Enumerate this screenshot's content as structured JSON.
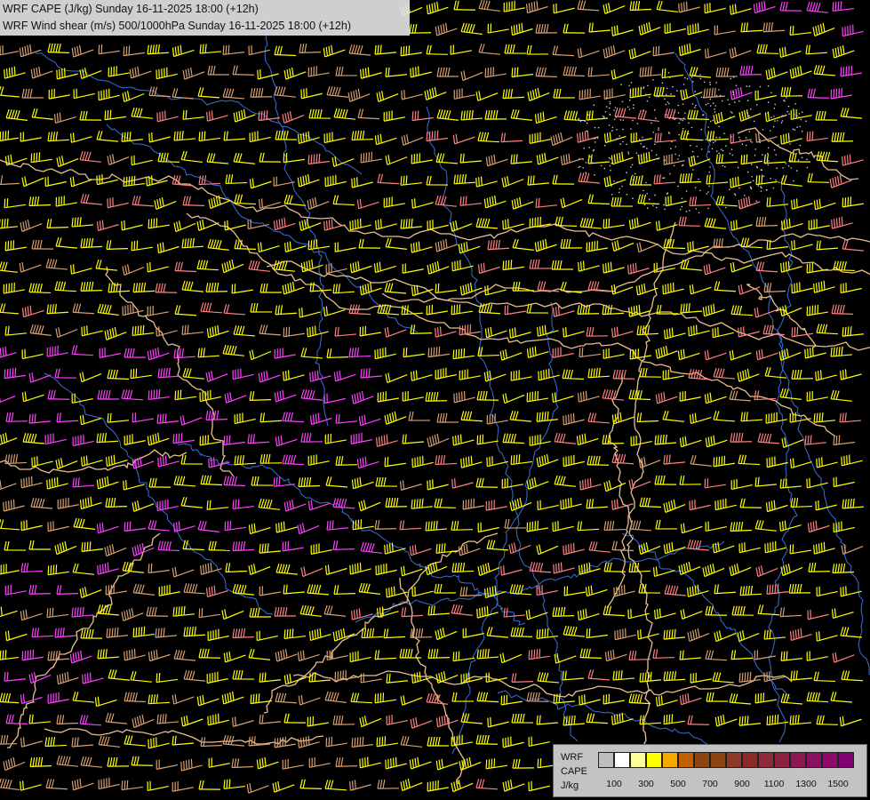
{
  "titles": {
    "line1": "WRF CAPE (J/kg) Sunday 16-11-2025 18:00 (+12h)",
    "line2": "WRF Wind shear (m/s) 500/1000hPa Sunday 16-11-2025 18:00 (+12h)"
  },
  "legend": {
    "line1": "WRF",
    "line2": "CAPE",
    "line3": "J/kg",
    "ticks": [
      "100",
      "300",
      "500",
      "700",
      "900",
      "1100",
      "1300",
      "1500"
    ],
    "colors": [
      "#bdbdbd",
      "#ffffff",
      "#ffff99",
      "#ffff00",
      "#f5a800",
      "#c06000",
      "#8b4513",
      "#8b4513",
      "#8b3a2a",
      "#8b2a2a",
      "#8b2a3a",
      "#8b2040",
      "#8b1a50",
      "#8b1060",
      "#8b0a6a",
      "#800070"
    ]
  },
  "map": {
    "barb_colors": {
      "weak": "#d8a070",
      "moderate": "#ffff00",
      "strong": "#ff8080",
      "very_strong": "#ff40ff"
    },
    "border_color": "#e8c090",
    "river_color": "#3a6fd8"
  }
}
